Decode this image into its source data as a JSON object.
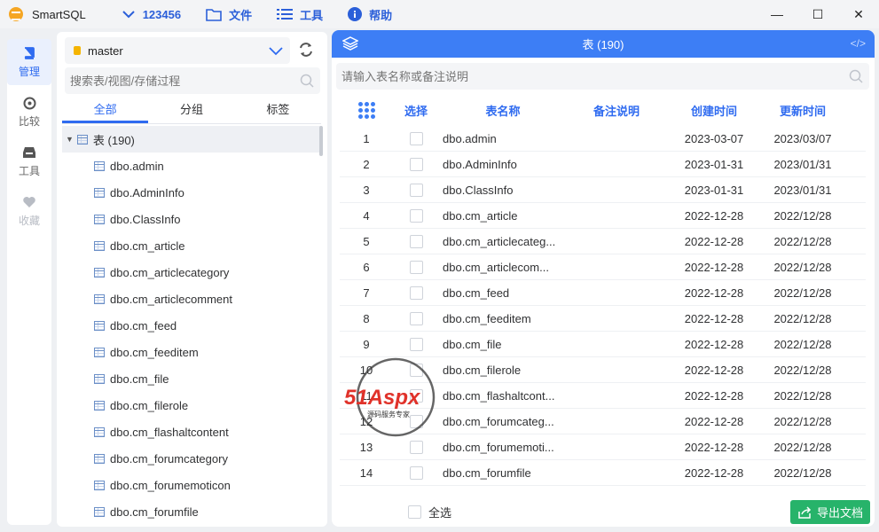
{
  "titlebar": {
    "app_name": "SmartSQL",
    "items": [
      {
        "label": "123456",
        "icon": "chevron-down-icon"
      },
      {
        "label": "文件",
        "icon": "folder-icon"
      },
      {
        "label": "工具",
        "icon": "list-icon"
      },
      {
        "label": "帮助",
        "icon": "info-icon"
      }
    ],
    "controls": {
      "minimize": "—",
      "maximize": "☐",
      "close": "✕"
    }
  },
  "leftnav": {
    "items": [
      {
        "label": "管理",
        "icon": "book-icon",
        "active": true
      },
      {
        "label": "比较",
        "icon": "compass-icon"
      },
      {
        "label": "工具",
        "icon": "inbox-icon"
      },
      {
        "label": "收藏",
        "icon": "heart-icon",
        "disabled": true
      }
    ]
  },
  "sidebar": {
    "database": "master",
    "search_placeholder": "搜索表/视图/存储过程",
    "tabs": [
      "全部",
      "分组",
      "标签"
    ],
    "root_label": "表 (190)",
    "items": [
      "dbo.admin",
      "dbo.AdminInfo",
      "dbo.ClassInfo",
      "dbo.cm_article",
      "dbo.cm_articlecategory",
      "dbo.cm_articlecomment",
      "dbo.cm_feed",
      "dbo.cm_feeditem",
      "dbo.cm_file",
      "dbo.cm_filerole",
      "dbo.cm_flashaltcontent",
      "dbo.cm_forumcategory",
      "dbo.cm_forumemoticon",
      "dbo.cm_forumfile"
    ]
  },
  "main": {
    "header_title": "表 (190)",
    "header_right": "</>",
    "search_placeholder": "请输入表名称或备注说明",
    "columns": [
      "选择",
      "表名称",
      "备注说明",
      "创建时间",
      "更新时间"
    ],
    "rows": [
      {
        "no": "1",
        "name": "dbo.admin",
        "memo": "",
        "created": "2023-03-07",
        "updated": "2023/03/07"
      },
      {
        "no": "2",
        "name": "dbo.AdminInfo",
        "memo": "",
        "created": "2023-01-31",
        "updated": "2023/01/31"
      },
      {
        "no": "3",
        "name": "dbo.ClassInfo",
        "memo": "",
        "created": "2023-01-31",
        "updated": "2023/01/31"
      },
      {
        "no": "4",
        "name": "dbo.cm_article",
        "memo": "",
        "created": "2022-12-28",
        "updated": "2022/12/28"
      },
      {
        "no": "5",
        "name": "dbo.cm_articlecateg...",
        "memo": "",
        "created": "2022-12-28",
        "updated": "2022/12/28"
      },
      {
        "no": "6",
        "name": "dbo.cm_articlecom...",
        "memo": "",
        "created": "2022-12-28",
        "updated": "2022/12/28"
      },
      {
        "no": "7",
        "name": "dbo.cm_feed",
        "memo": "",
        "created": "2022-12-28",
        "updated": "2022/12/28"
      },
      {
        "no": "8",
        "name": "dbo.cm_feeditem",
        "memo": "",
        "created": "2022-12-28",
        "updated": "2022/12/28"
      },
      {
        "no": "9",
        "name": "dbo.cm_file",
        "memo": "",
        "created": "2022-12-28",
        "updated": "2022/12/28"
      },
      {
        "no": "10",
        "name": "dbo.cm_filerole",
        "memo": "",
        "created": "2022-12-28",
        "updated": "2022/12/28"
      },
      {
        "no": "11",
        "name": "dbo.cm_flashaltcont...",
        "memo": "",
        "created": "2022-12-28",
        "updated": "2022/12/28"
      },
      {
        "no": "12",
        "name": "dbo.cm_forumcateg...",
        "memo": "",
        "created": "2022-12-28",
        "updated": "2022/12/28"
      },
      {
        "no": "13",
        "name": "dbo.cm_forumemoti...",
        "memo": "",
        "created": "2022-12-28",
        "updated": "2022/12/28"
      },
      {
        "no": "14",
        "name": "dbo.cm_forumfile",
        "memo": "",
        "created": "2022-12-28",
        "updated": "2022/12/28"
      }
    ],
    "select_all_label": "全选",
    "export_label": "导出文档"
  },
  "watermark": {
    "brand": "51Aspx",
    "tagline": "源码服务专家"
  },
  "colors": {
    "accent": "#3d7ef5",
    "export": "#27b36a",
    "nav_active": "#2f6bf0"
  }
}
